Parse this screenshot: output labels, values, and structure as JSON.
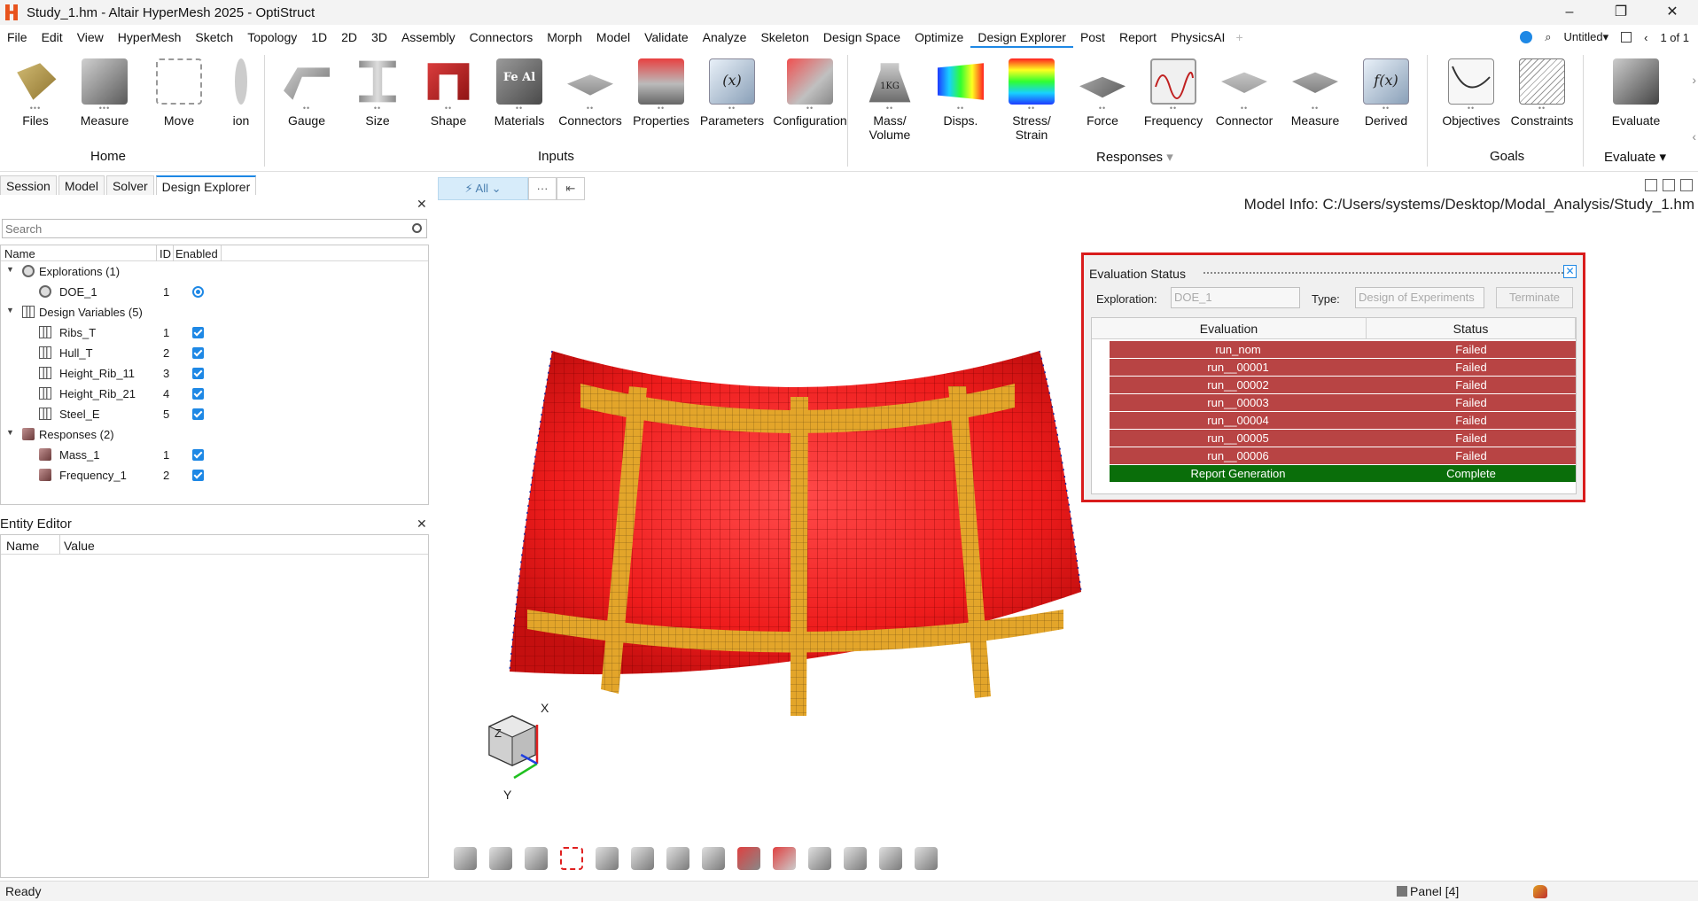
{
  "window": {
    "title": "Study_1.hm - Altair HyperMesh 2025 - OptiStruct",
    "controls": [
      "–",
      "❐",
      "✕"
    ]
  },
  "menu": {
    "items": [
      "File",
      "Edit",
      "View",
      "HyperMesh",
      "Sketch",
      "Topology",
      "1D",
      "2D",
      "3D",
      "Assembly",
      "Connectors",
      "Morph",
      "Model",
      "Validate",
      "Analyze",
      "Skeleton",
      "Design Space",
      "Optimize",
      "Design Explorer",
      "Post",
      "Report",
      "PhysicsAI"
    ],
    "active": "Design Explorer",
    "add": "+",
    "untitled": "Untitled",
    "page": "1 of 1"
  },
  "ribbon": {
    "groups": {
      "home": "Home",
      "inputs": "Inputs",
      "responses": "Responses",
      "goals": "Goals",
      "evaluate": "Evaluate"
    },
    "tools": {
      "files": "Files",
      "measure": "Measure",
      "move": "Move",
      "ion": "ion",
      "gauge": "Gauge",
      "size": "Size",
      "shape": "Shape",
      "materials": "Materials",
      "connectors": "Connectors",
      "properties": "Properties",
      "parameters": "Parameters",
      "configuration": "Configuration",
      "mass1": "Mass/",
      "mass2": "Volume",
      "disps": "Disps.",
      "stress1": "Stress/",
      "stress2": "Strain",
      "force": "Force",
      "frequency": "Frequency",
      "connector": "Connector",
      "measure2": "Measure",
      "derived": "Derived",
      "objectives": "Objectives",
      "constraints": "Constraints",
      "evaluate": "Evaluate"
    },
    "icon_text": {
      "materials": "Fe Al",
      "parameters": "(x)",
      "derived": "f(x)",
      "mass": "1KG"
    }
  },
  "panel_tabs": [
    "Session",
    "Model",
    "Solver",
    "Design Explorer"
  ],
  "active_panel_tab": "Design Explorer",
  "search": {
    "placeholder": "Search"
  },
  "tree": {
    "headers": {
      "name": "Name",
      "id": "ID",
      "enabled": "Enabled"
    },
    "explorations": {
      "label": "Explorations (1)",
      "items": [
        {
          "name": "DOE_1",
          "id": "1"
        }
      ]
    },
    "design_variables": {
      "label": "Design Variables (5)",
      "items": [
        {
          "name": "Ribs_T",
          "id": "1"
        },
        {
          "name": "Hull_T",
          "id": "2"
        },
        {
          "name": "Height_Rib_11",
          "id": "3"
        },
        {
          "name": "Height_Rib_21",
          "id": "4"
        },
        {
          "name": "Steel_E",
          "id": "5"
        }
      ]
    },
    "responses": {
      "label": "Responses (2)",
      "items": [
        {
          "name": "Mass_1",
          "id": "1"
        },
        {
          "name": "Frequency_1",
          "id": "2"
        }
      ]
    }
  },
  "entity_editor": {
    "title": "Entity Editor",
    "headers": {
      "name": "Name",
      "value": "Value"
    }
  },
  "viewport": {
    "filter_label": "⚡ All ⌄",
    "more": "···",
    "first": "⇤",
    "model_info": "Model Info: C:/Users/systems/Desktop/Modal_Analysis/Study_1.hm",
    "triad": {
      "x": "X",
      "y": "Y",
      "z": "Z"
    }
  },
  "eval_status": {
    "title": "Evaluation Status",
    "exploration_label": "Exploration:",
    "exploration_value": "DOE_1",
    "type_label": "Type:",
    "type_value": "Design of Experiments",
    "terminate": "Terminate",
    "headers": {
      "evaluation": "Evaluation",
      "status": "Status"
    },
    "rows": [
      {
        "evaluation": "run_nom",
        "status": "Failed"
      },
      {
        "evaluation": "run__00001",
        "status": "Failed"
      },
      {
        "evaluation": "run__00002",
        "status": "Failed"
      },
      {
        "evaluation": "run__00003",
        "status": "Failed"
      },
      {
        "evaluation": "run__00004",
        "status": "Failed"
      },
      {
        "evaluation": "run__00005",
        "status": "Failed"
      },
      {
        "evaluation": "run__00006",
        "status": "Failed"
      },
      {
        "evaluation": "Report Generation",
        "status": "Complete"
      }
    ],
    "colors": {
      "failed": "#b84444",
      "complete": "#0a6e0a"
    }
  },
  "status_bar": {
    "left": "Ready",
    "panel": "Panel [4]"
  }
}
